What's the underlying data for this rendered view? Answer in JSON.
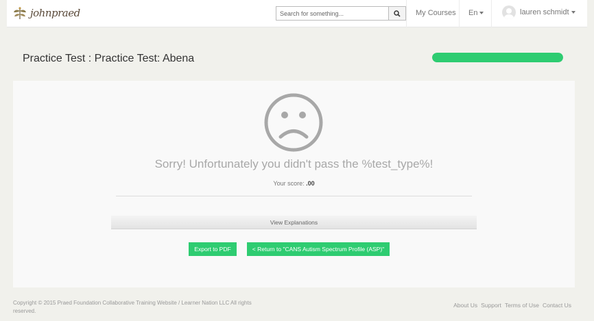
{
  "header": {
    "logo_text": "johnpraed",
    "search": {
      "placeholder": "Search for something...",
      "value": ""
    },
    "nav": {
      "my_courses": "My Courses",
      "language": "En",
      "user_name": "lauren schmidt"
    }
  },
  "page": {
    "title": "Practice Test : Practice Test: Abena",
    "progress_percent": 100
  },
  "result": {
    "message": "Sorry! Unfortunately you didn't pass the %test_type%!",
    "score_label": "Your score: ",
    "score_value": ".00",
    "view_explanations": "View Explanations",
    "export_pdf": "Export to PDF",
    "return_label": "< Return to \"CANS Autism Spectrum Profile (ASP)\""
  },
  "footer": {
    "copyright": "Copyright © 2015 Praed Foundation Collaborative Training Website / Learner Nation LLC All rights reserved.",
    "links": [
      "About Us",
      "Support",
      "Terms of Use",
      "Contact Us"
    ]
  },
  "colors": {
    "accent_green": "#2ecc71",
    "face_gray": "#a8a8a8"
  }
}
